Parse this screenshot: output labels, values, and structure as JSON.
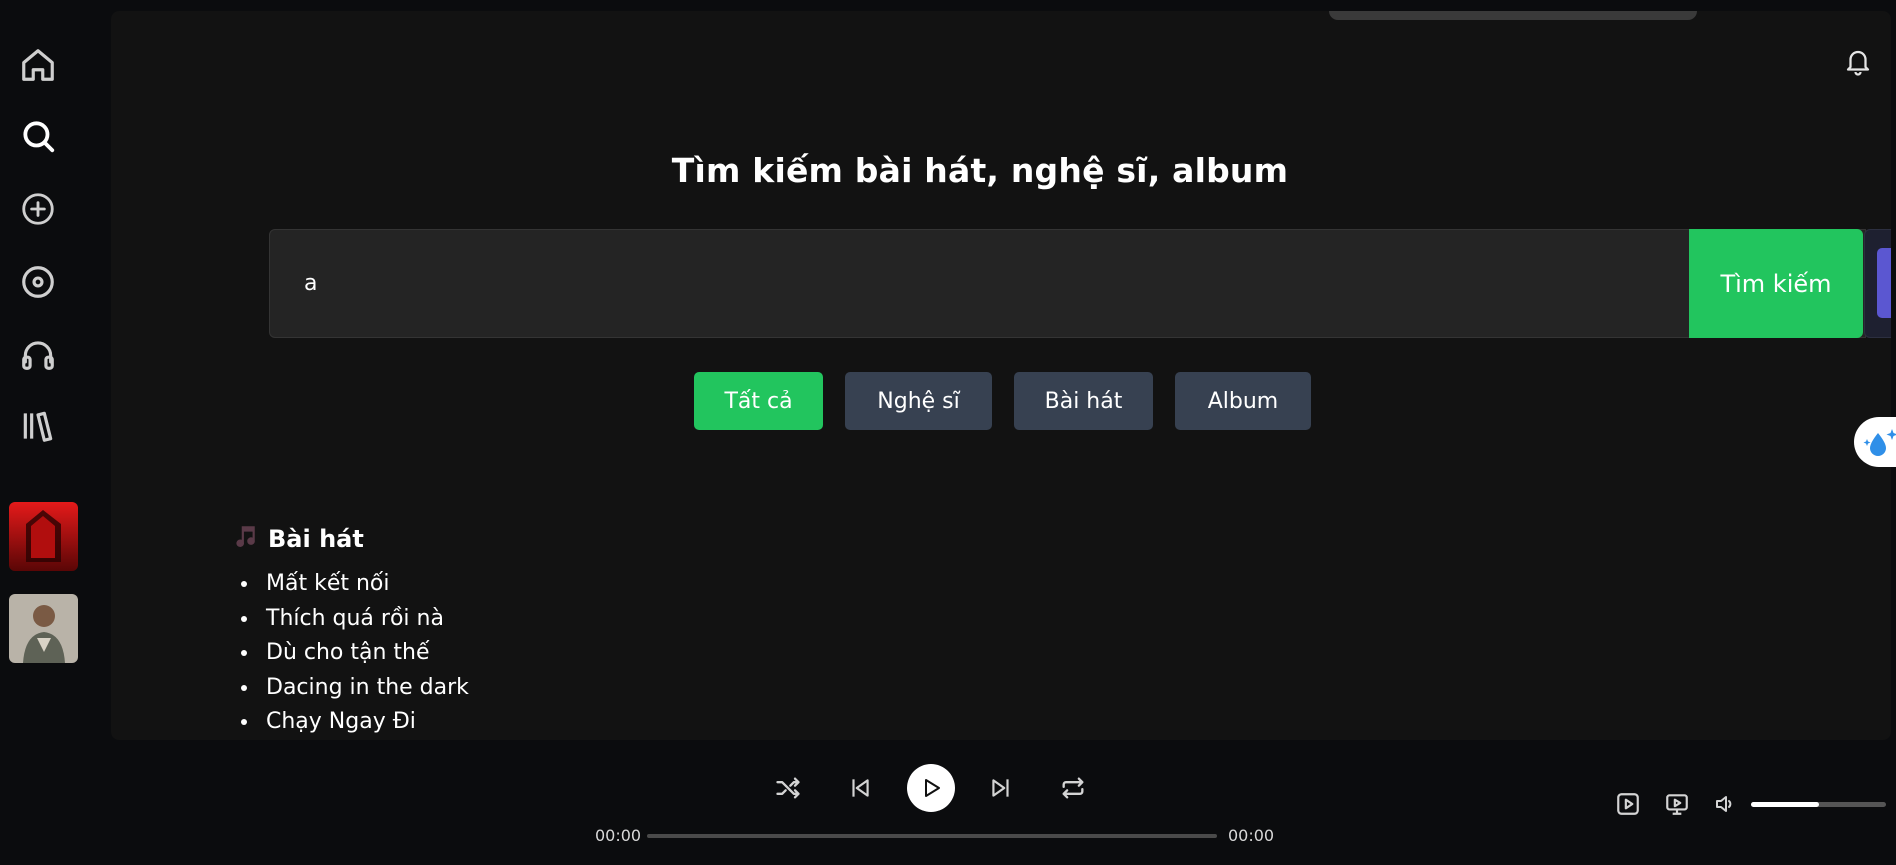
{
  "sidebar": {
    "items": [
      {
        "icon": "home-icon"
      },
      {
        "icon": "search-icon"
      },
      {
        "icon": "add-circle-icon"
      },
      {
        "icon": "disc-icon"
      },
      {
        "icon": "headphones-icon"
      },
      {
        "icon": "library-icon"
      }
    ],
    "thumbnails": [
      {
        "icon": "album-cover"
      },
      {
        "icon": "artist-photo"
      }
    ]
  },
  "header": {
    "notification_icon": "bell-icon",
    "avatar_icon": "user-avatar-icon"
  },
  "search": {
    "title": "Tìm kiếm bài hát, nghệ sĩ, album",
    "query": "a",
    "button_label": "Tìm kiếm",
    "mic_icon": "microphone-icon"
  },
  "filters": [
    {
      "label": "Tất cả",
      "active": true
    },
    {
      "label": "Nghệ sĩ",
      "active": false
    },
    {
      "label": "Bài hát",
      "active": false
    },
    {
      "label": "Album",
      "active": false
    }
  ],
  "results": {
    "section_title": "Bài hát",
    "section_icon": "music-note-icon",
    "songs": [
      "Mất kết nối",
      "Thích quá rồi nà",
      "Dù cho tận thế",
      "Dacing in the dark",
      "Chạy Ngay Đi"
    ]
  },
  "player": {
    "current_time": "00:00",
    "duration": "00:00",
    "progress": 0,
    "volume": 0.5,
    "colors": {
      "accent": "#22c55e",
      "mic": "#5b57d1",
      "chip": "#374151"
    }
  }
}
